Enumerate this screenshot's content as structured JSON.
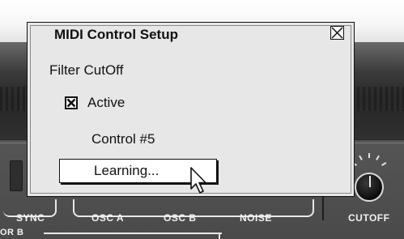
{
  "dialog": {
    "title": "MIDI Control Setup",
    "parameter": "Filter CutOff",
    "active": {
      "label": "Active",
      "checked": true
    },
    "control": "Control #5",
    "learn_button": "Learning..."
  },
  "synth_panel": {
    "labels": {
      "sync": "SYNC",
      "osc_a": "OSC A",
      "osc_b": "OSC B",
      "noise": "NOISE",
      "cutoff": "CUTOFF",
      "osc_b_section": "OR B"
    }
  },
  "icons": {
    "close": "close-x-icon",
    "checkbox": "checkbox-checked-icon",
    "cursor": "arrow-cursor-icon",
    "knob": "cutoff-knob"
  },
  "colors": {
    "dialog_bg": "#e7e7e7",
    "button_bg": "#ffffff",
    "panel_bg": "#4a4a4a",
    "panel_text": "#f2f2f2"
  }
}
